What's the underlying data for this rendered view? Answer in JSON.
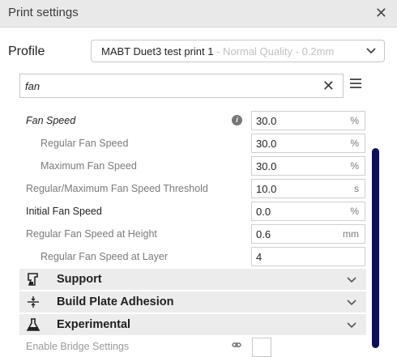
{
  "window": {
    "title": "Print settings",
    "close_icon": "close-icon"
  },
  "profile": {
    "label": "Profile",
    "name": "MABT Duet3 test print 1",
    "quality": " - Normal Quality - 0.2mm"
  },
  "search": {
    "value": "fan",
    "clear_icon": "clear-icon",
    "menu_icon": "menu-icon"
  },
  "settings": [
    {
      "label": "Fan Speed",
      "value": "30.0",
      "unit": "%"
    },
    {
      "label": "Regular Fan Speed",
      "value": "30.0",
      "unit": "%"
    },
    {
      "label": "Maximum Fan Speed",
      "value": "30.0",
      "unit": "%"
    },
    {
      "label": "Regular/Maximum Fan Speed Threshold",
      "value": "10.0",
      "unit": "s"
    },
    {
      "label": "Initial Fan Speed",
      "value": "0.0",
      "unit": "%"
    },
    {
      "label": "Regular Fan Speed at Height",
      "value": "0.6",
      "unit": "mm"
    },
    {
      "label": "Regular Fan Speed at Layer",
      "value": "4",
      "unit": ""
    }
  ],
  "categories": [
    {
      "label": "Support",
      "icon": "support-icon"
    },
    {
      "label": "Build Plate Adhesion",
      "icon": "build-plate-adhesion-icon"
    },
    {
      "label": "Experimental",
      "icon": "experimental-flask-icon"
    }
  ],
  "partial_row": {
    "label": "Enable Bridge Settings"
  },
  "colors": {
    "scrollbar": "#0f0f5c",
    "category_bg": "#ececec",
    "muted_text": "#7a7a7a"
  }
}
